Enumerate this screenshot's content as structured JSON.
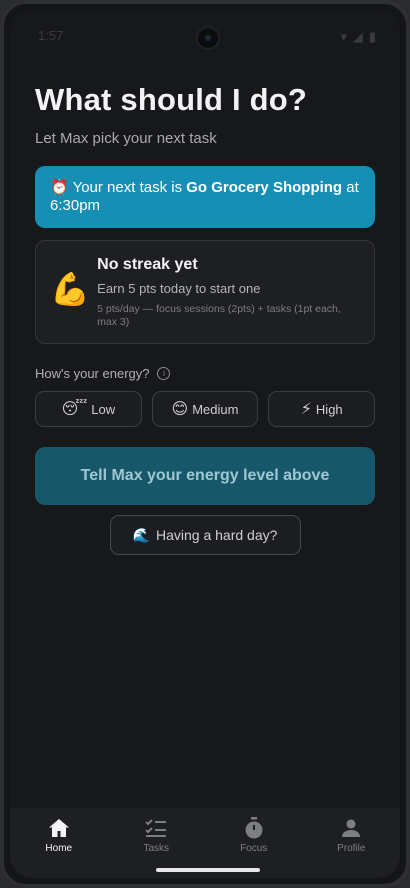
{
  "status": {
    "time": "1:57"
  },
  "page": {
    "title": "What should I do?",
    "subtitle": "Let Max pick your next task"
  },
  "next_task": {
    "prefix": "⏰ Your next task is ",
    "task": "Go Grocery Shopping",
    "suffix": " at 6:30pm"
  },
  "streak": {
    "emoji": "💪",
    "title": "No streak yet",
    "subtitle": "Earn 5 pts today to start one",
    "note": "5 pts/day — focus sessions (2pts) + tasks (1pt each, max 3)"
  },
  "energy": {
    "label": "How's your energy?",
    "info_icon": "i",
    "options": [
      {
        "emoji": "😴",
        "label": "Low"
      },
      {
        "emoji": "😊",
        "label": "Medium"
      },
      {
        "emoji": "⚡",
        "label": "High"
      }
    ]
  },
  "cta": {
    "label": "Tell Max your energy level above"
  },
  "hard_day": {
    "emoji": "🌊",
    "label": "Having a hard day?"
  },
  "nav": [
    {
      "label": "Home",
      "icon": "home-icon",
      "active": true
    },
    {
      "label": "Tasks",
      "icon": "checklist-icon",
      "active": false
    },
    {
      "label": "Focus",
      "icon": "timer-icon",
      "active": false
    },
    {
      "label": "Profile",
      "icon": "person-icon",
      "active": false
    }
  ],
  "colors": {
    "accent": "#1590b4",
    "cta": "#16586a",
    "background": "#17181a"
  }
}
